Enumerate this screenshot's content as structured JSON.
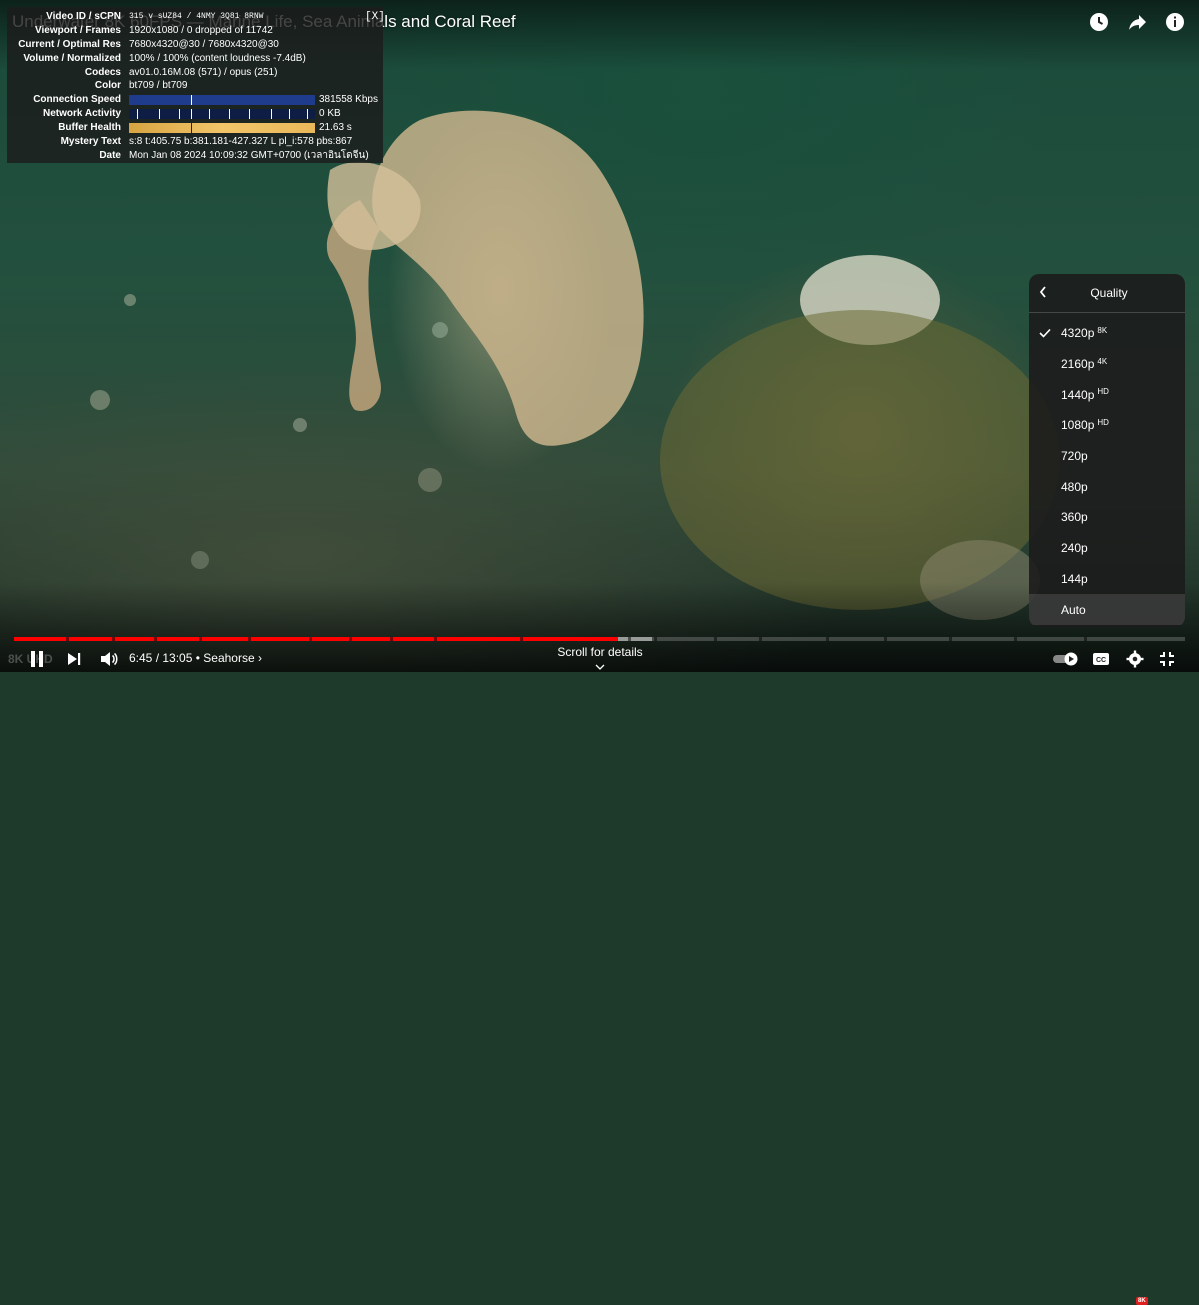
{
  "video": {
    "title": "Underwater 8K 60FPS — Marine Life, Sea Animals and Coral Reef",
    "watermark": "8K UHD"
  },
  "top_icons": [
    "watch-later-icon",
    "share-icon",
    "info-icon"
  ],
  "stats": {
    "close_label": "[X]",
    "rows": [
      {
        "label": "Video ID / sCPN",
        "value": "315 v sUZ84 / 4NMY 3Q81 8RNW"
      },
      {
        "label": "Viewport / Frames",
        "value": "1920x1080 / 0 dropped of 11742"
      },
      {
        "label": "Current / Optimal Res",
        "value": "7680x4320@30 / 7680x4320@30"
      },
      {
        "label": "Volume / Normalized",
        "value": "100% / 100% (content loudness -7.4dB)"
      },
      {
        "label": "Codecs",
        "value": "av01.0.16M.08 (571) / opus (251)"
      },
      {
        "label": "Color",
        "value": "bt709 / bt709"
      },
      {
        "label": "Connection Speed",
        "value": "381558 Kbps"
      },
      {
        "label": "Network Activity",
        "value": "0 KB"
      },
      {
        "label": "Buffer Health",
        "value": "21.63 s"
      },
      {
        "label": "Mystery Text",
        "value": "s:8 t:405.75 b:381.181-427.327 L pl_i:578 pbs:867"
      },
      {
        "label": "Date",
        "value": "Mon Jan 08 2024 10:09:32 GMT+0700 (เวลาอินโดจีน)"
      }
    ],
    "colors": {
      "speed": "#1f3c8c",
      "network": "#0d1d44",
      "buffer": "#f2c56a"
    }
  },
  "quality_menu": {
    "title": "Quality",
    "back_icon": "chevron-left-icon",
    "selected": "4320p",
    "items": [
      {
        "label": "4320p",
        "badge": "8K"
      },
      {
        "label": "2160p",
        "badge": "4K"
      },
      {
        "label": "1440p",
        "badge": "HD"
      },
      {
        "label": "1080p",
        "badge": "HD"
      },
      {
        "label": "720p",
        "badge": ""
      },
      {
        "label": "480p",
        "badge": ""
      },
      {
        "label": "360p",
        "badge": ""
      },
      {
        "label": "240p",
        "badge": ""
      },
      {
        "label": "144p",
        "badge": ""
      },
      {
        "label": "Auto",
        "badge": ""
      }
    ]
  },
  "player": {
    "current_time": "6:45",
    "duration": "13:05",
    "separator": " / ",
    "chapter": "• Seahorse",
    "chapter_chevron": "›",
    "scroll_hint": "Scroll for details",
    "played_fraction": 0.516,
    "buffered_fraction": 0.545,
    "badge_8k": "8K",
    "accent_color": "#ff0000"
  }
}
